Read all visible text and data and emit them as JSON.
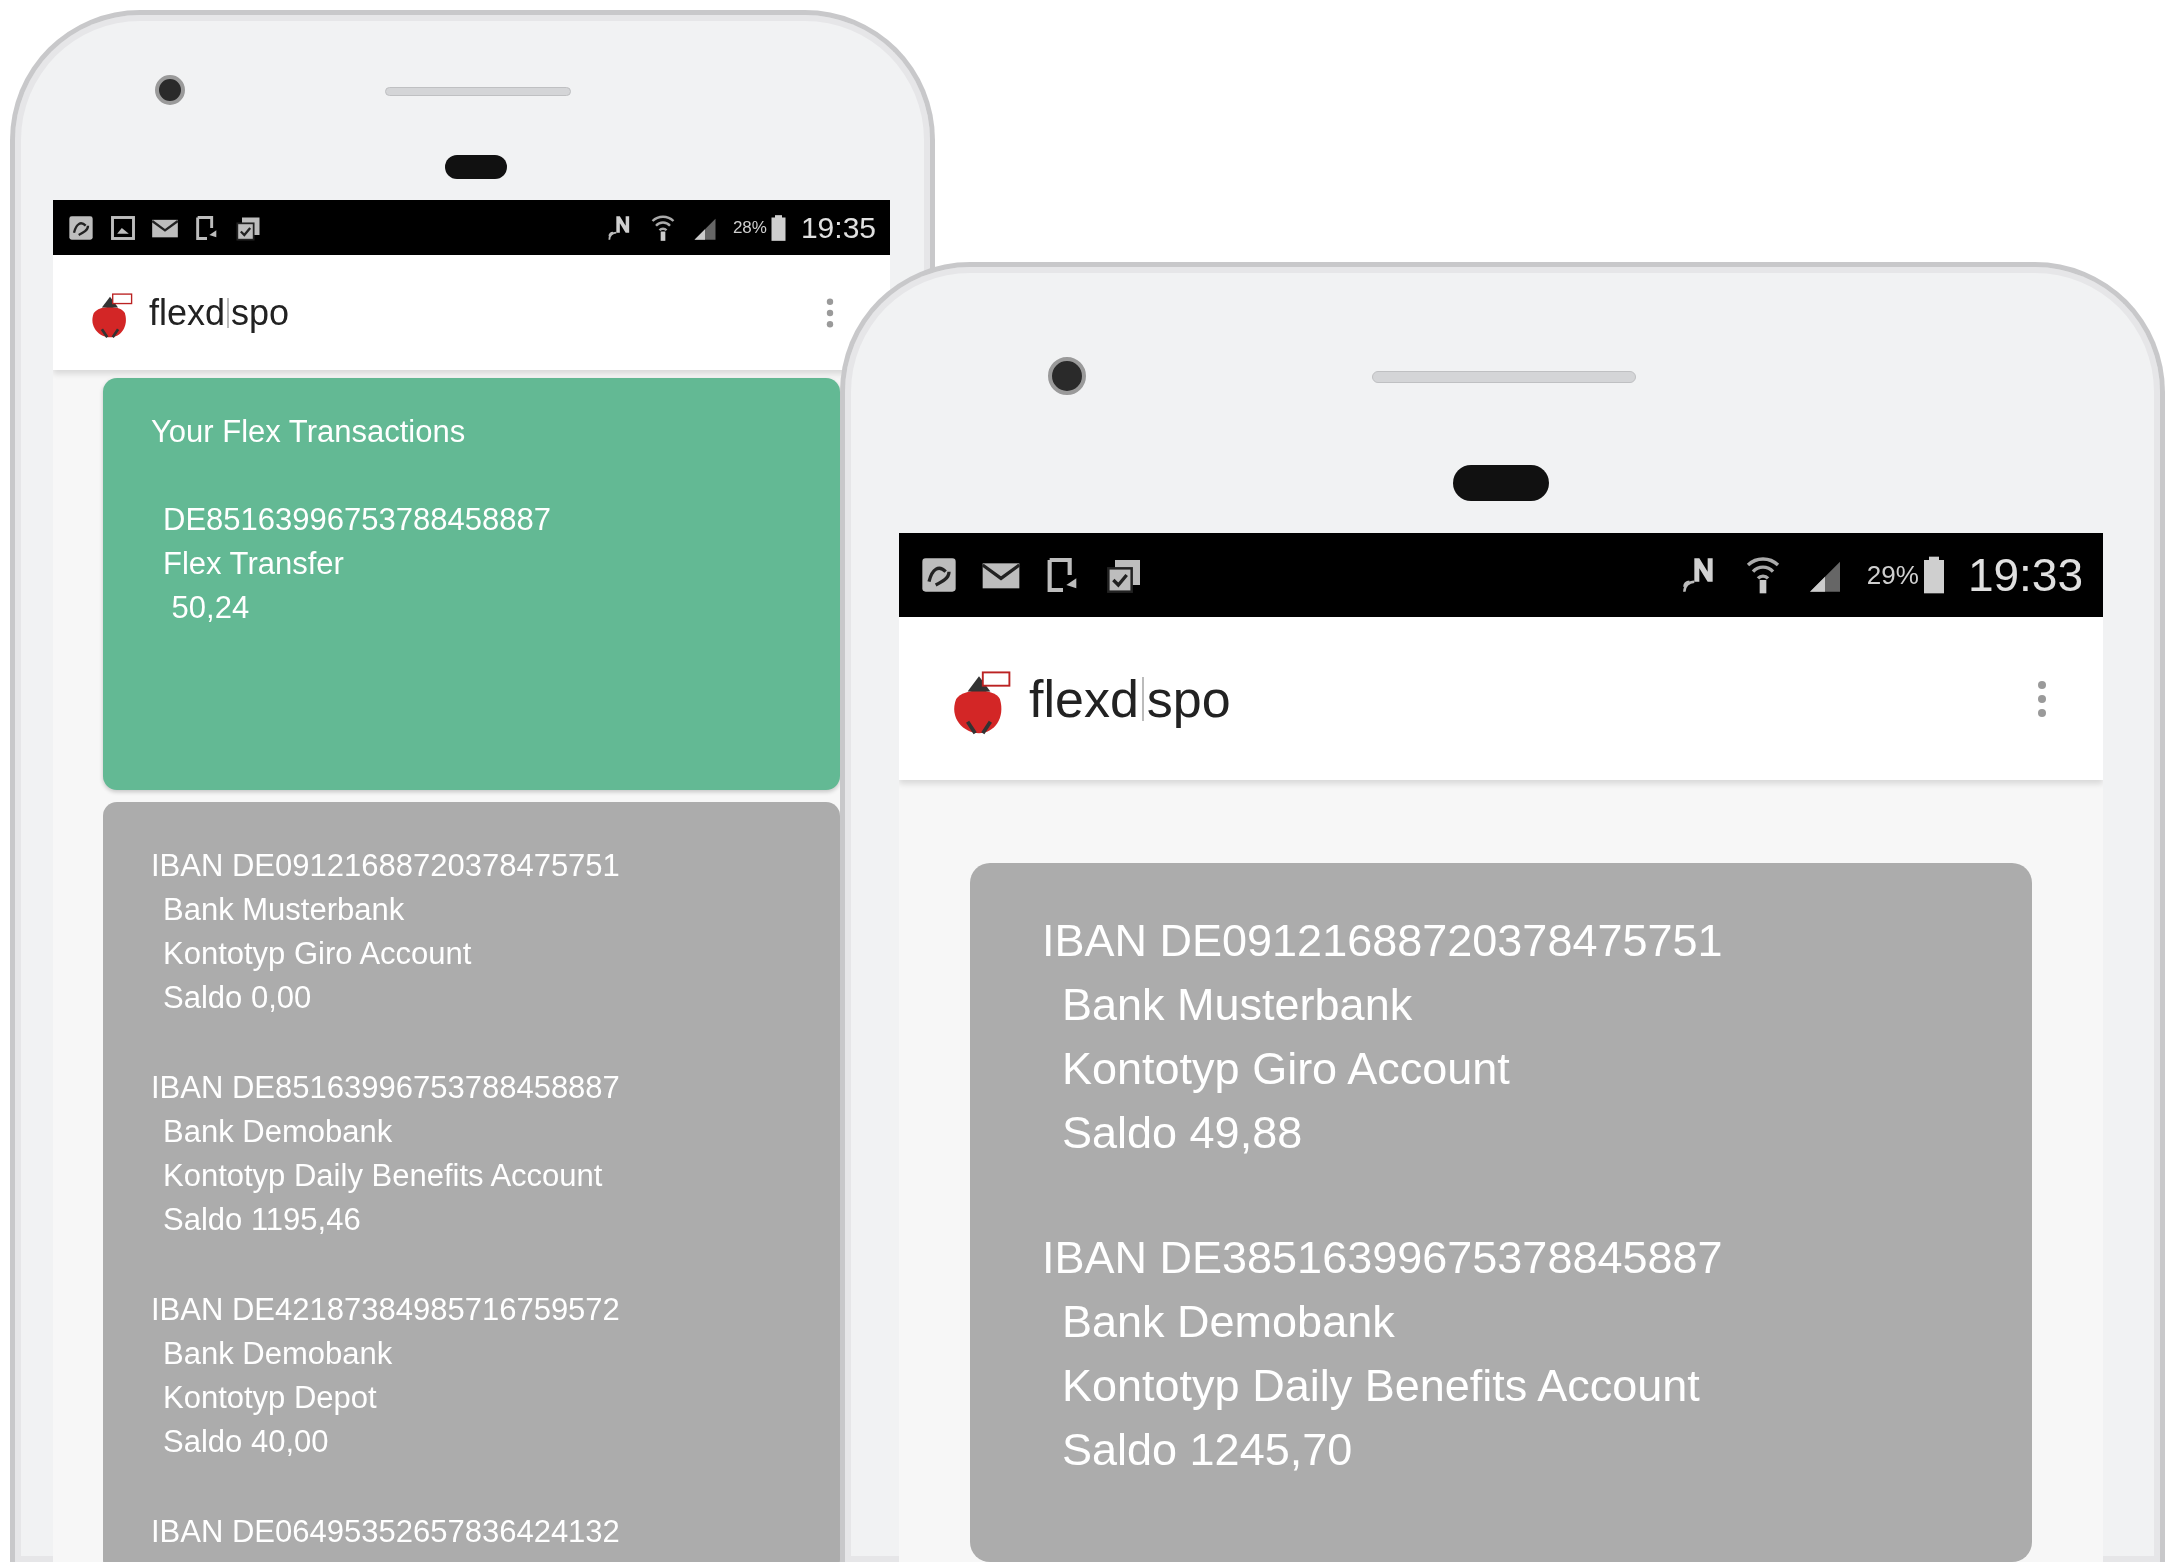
{
  "phones": [
    {
      "status_bar": {
        "notifications": [
          {
            "kind": "photo"
          },
          {
            "kind": "gallery"
          },
          {
            "kind": "mail"
          },
          {
            "kind": "screen"
          },
          {
            "kind": "update"
          }
        ],
        "battery": "28%",
        "time": "19:35"
      },
      "app_bar": {
        "brand_left": "flexd",
        "brand_right": "spo"
      },
      "cards": [
        {
          "kind": "transactions",
          "title": "Your Flex Transactions",
          "lines": [
            "DE85163996753788458887",
            "Flex Transfer",
            " 50,24"
          ]
        },
        {
          "kind": "accounts",
          "accounts": [
            {
              "iban": "IBAN DE09121688720378475751",
              "bank": "Bank Musterbank",
              "type": "Kontotyp Giro Account",
              "saldo": "Saldo 0,00"
            },
            {
              "iban": "IBAN DE85163996753788458887",
              "bank": "Bank Demobank",
              "type": "Kontotyp Daily Benefits Account",
              "saldo": "Saldo 1195,46"
            },
            {
              "iban": "IBAN DE42187384985716759572",
              "bank": "Bank Demobank",
              "type": "Kontotyp Depot",
              "saldo": "Saldo 40,00"
            },
            {
              "iban": "IBAN DE06495352657836424132"
            }
          ]
        }
      ]
    },
    {
      "status_bar": {
        "notifications": [
          {
            "kind": "photo"
          },
          {
            "kind": "mail"
          },
          {
            "kind": "screen"
          },
          {
            "kind": "update"
          }
        ],
        "battery": "29%",
        "time": "19:33"
      },
      "app_bar": {
        "brand_left": "flexd",
        "brand_right": "spo"
      },
      "cards": [
        {
          "kind": "accounts",
          "accounts": [
            {
              "iban": "IBAN DE09121688720378475751",
              "bank": "Bank Musterbank",
              "type": "Kontotyp Giro Account",
              "saldo": "Saldo 49,88"
            },
            {
              "iban": "IBAN DE38516399675378845887",
              "bank": "Bank Demobank",
              "type": "Kontotyp Daily Benefits Account",
              "saldo": "Saldo 1245,70"
            }
          ]
        }
      ]
    }
  ]
}
